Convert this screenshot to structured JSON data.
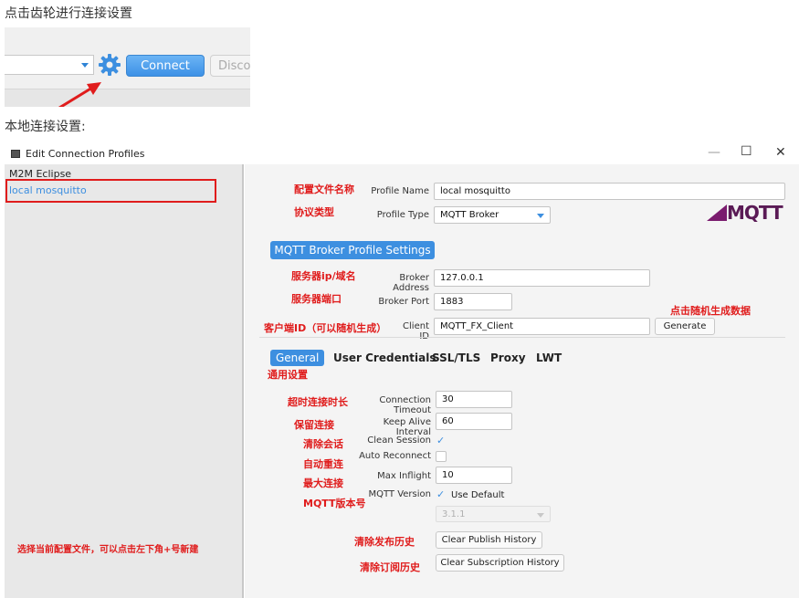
{
  "doc": {
    "caption_gear": "点击齿轮进行连接设置",
    "caption_local": "本地连接设置:"
  },
  "toolbar": {
    "connect_label": "Connect",
    "disconnect_label": "Disco"
  },
  "dialog": {
    "title": "Edit Connection Profiles",
    "minimize": "—",
    "maximize": "☐",
    "close": "✕",
    "profiles": [
      "M2M Eclipse",
      "local mosquitto"
    ],
    "profile_name_label": "Profile Name",
    "profile_name_value": "local mosquitto",
    "profile_type_label": "Profile Type",
    "profile_type_value": "MQTT Broker",
    "logo_text": "MQTT",
    "section_title": "MQTT Broker Profile Settings",
    "broker_address_label": "Broker Address",
    "broker_address_value": "127.0.0.1",
    "broker_port_label": "Broker Port",
    "broker_port_value": "1883",
    "client_id_label": "Client ID",
    "client_id_value": "MQTT_FX_Client",
    "generate_label": "Generate",
    "tabs": [
      "General",
      "User Credentials",
      "SSL/TLS",
      "Proxy",
      "LWT"
    ],
    "connection_timeout_label": "Connection Timeout",
    "connection_timeout_value": "30",
    "keep_alive_label": "Keep Alive Interval",
    "keep_alive_value": "60",
    "clean_session_label": "Clean Session",
    "auto_reconnect_label": "Auto Reconnect",
    "max_inflight_label": "Max Inflight",
    "max_inflight_value": "10",
    "mqtt_version_label": "MQTT Version",
    "use_default_label": "Use Default",
    "mqtt_version_value": "3.1.1",
    "clear_publish_label": "Clear Publish History",
    "clear_subscription_label": "Clear Subscription History",
    "checkmark": "✓"
  },
  "annotations": {
    "profile_name": "配置文件名称",
    "protocol": "协议类型",
    "server_ip": "服务器ip/域名",
    "server_port": "服务器端口",
    "random_gen": "点击随机生成数据",
    "client_id": "客户端ID（可以随机生成）",
    "general": "通用设置",
    "timeout": "超时连接时长",
    "keep_alive": "保留连接",
    "clean_session": "清除会话",
    "auto_reconnect": "自动重连",
    "max_conn": "最大连接",
    "version": "MQTT版本号",
    "select_profile": "选择当前配置文件，可以点击左下角+号新建",
    "clear_publish": "清除发布历史",
    "clear_subscription": "清除订阅历史"
  },
  "colors": {
    "accent_blue": "#3d8fe0",
    "annotation_red": "#e01c1c"
  }
}
